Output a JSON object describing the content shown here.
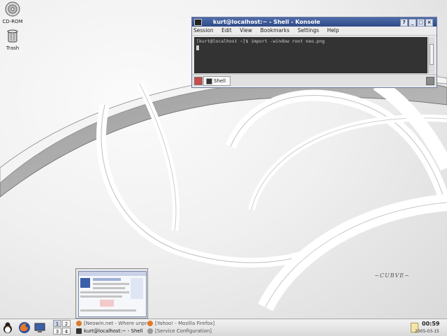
{
  "desktop": {
    "icons": [
      {
        "label": "CD-ROM",
        "icon": "cdrom-icon"
      },
      {
        "label": "Trash",
        "icon": "trash-icon"
      }
    ],
    "wallpaper_text": "~CUBVE~"
  },
  "konsole": {
    "title": "kurt@localhost:~ - Shell - Konsole",
    "menu": [
      "Session",
      "Edit",
      "View",
      "Bookmarks",
      "Settings",
      "Help"
    ],
    "prompt_line": "[kurt@localhost ~]$ import -window root neo.png",
    "tab_label": "Shell",
    "window_buttons": [
      "?",
      "_",
      "□",
      "×"
    ]
  },
  "taskbar": {
    "pager": [
      "1",
      "2",
      "3",
      "4"
    ],
    "tasks": [
      {
        "label": "[Neowin.net - Where unpro",
        "icon_color": "#e07a2a"
      },
      {
        "label": "[Yahoo! - Mozilla Firefox]",
        "icon_color": "#e07a2a"
      },
      {
        "label": "kurt@localhost:~ - Shell",
        "icon_color": "#333333"
      },
      {
        "label": "[Service Configuration]",
        "icon_color": "#9a9a9a"
      }
    ],
    "clock": "00:59",
    "date": "2005-03-15"
  },
  "colors": {
    "titlebar": "#3a5a98",
    "terminal_bg": "#333333",
    "terminal_fg": "#cfcfcf"
  }
}
